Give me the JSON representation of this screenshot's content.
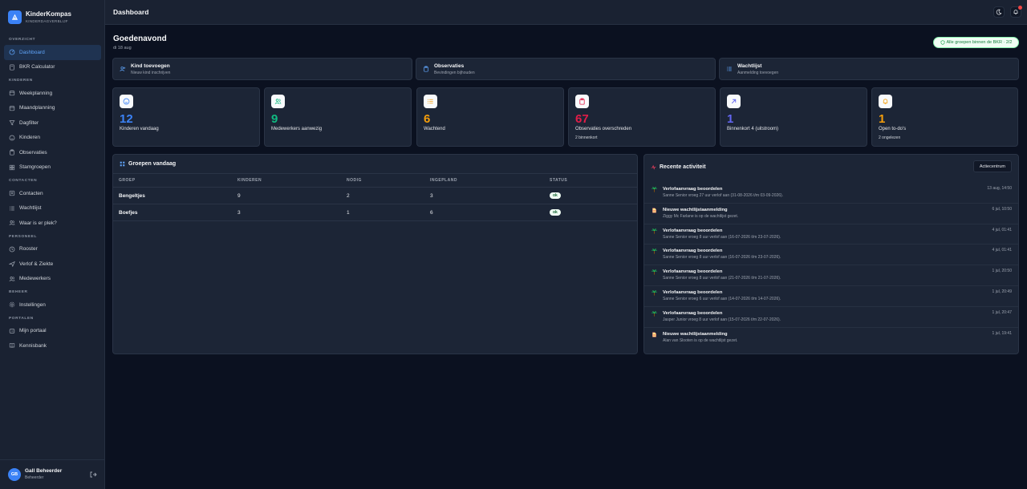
{
  "brand": {
    "name": "KinderKompas",
    "subtitle": "KINDERDAGVERBLIJF"
  },
  "nav": {
    "sections": [
      {
        "title": "OVERZICHT",
        "items": [
          {
            "label": "Dashboard",
            "icon": "dashboard-icon",
            "active": true
          },
          {
            "label": "BKR Calculator",
            "icon": "calculator-icon"
          }
        ]
      },
      {
        "title": "KINDEREN",
        "items": [
          {
            "label": "Weekplanning",
            "icon": "calendar-icon"
          },
          {
            "label": "Maandplanning",
            "icon": "calendar-icon"
          },
          {
            "label": "Dagfilter",
            "icon": "filter-icon"
          },
          {
            "label": "Kinderen",
            "icon": "smile-icon"
          },
          {
            "label": "Observaties",
            "icon": "clipboard-icon"
          },
          {
            "label": "Stamgroepen",
            "icon": "grid-icon"
          }
        ]
      },
      {
        "title": "CONTACTEN",
        "items": [
          {
            "label": "Contacten",
            "icon": "contact-icon"
          },
          {
            "label": "Wachtlijst",
            "icon": "list-icon"
          },
          {
            "label": "Waar is er plek?",
            "icon": "users-icon"
          }
        ]
      },
      {
        "title": "PERSONEEL",
        "items": [
          {
            "label": "Rooster",
            "icon": "clock-icon"
          },
          {
            "label": "Verlof & Ziekte",
            "icon": "plane-icon"
          },
          {
            "label": "Medewerkers",
            "icon": "users-icon"
          }
        ]
      },
      {
        "title": "BEHEER",
        "items": [
          {
            "label": "Instellingen",
            "icon": "gear-icon"
          }
        ]
      },
      {
        "title": "PORTALEN",
        "items": [
          {
            "label": "Mijn portaal",
            "icon": "portal-icon"
          },
          {
            "label": "Kennisbank",
            "icon": "book-icon"
          }
        ]
      }
    ]
  },
  "user": {
    "initials": "GB",
    "name": "Gall Beheerder",
    "role": "Beheerder"
  },
  "topbar": {
    "title": "Dashboard"
  },
  "header": {
    "greeting": "Goedenavond",
    "date": "di 18 aug",
    "bkr_status": "Alle groepen binnen de BKR · 2/2"
  },
  "quick_actions": [
    {
      "title": "Kind toevoegen",
      "subtitle": "Nieuw kind inschrijven",
      "icon": "user-plus-icon"
    },
    {
      "title": "Observaties",
      "subtitle": "Bevindingen bijhouden",
      "icon": "clipboard-icon"
    },
    {
      "title": "Wachtlijst",
      "subtitle": "Aanmelding toevoegen",
      "icon": "list-icon"
    }
  ],
  "stats": [
    {
      "value": "12",
      "label": "Kinderen vandaag",
      "sub": "",
      "color": "#3b82f6",
      "icon": "smile-icon"
    },
    {
      "value": "9",
      "label": "Medewerkers aanwezig",
      "sub": "",
      "color": "#10b981",
      "icon": "users-icon"
    },
    {
      "value": "6",
      "label": "Wachtend",
      "sub": "",
      "color": "#f59e0b",
      "icon": "list-icon"
    },
    {
      "value": "67",
      "label": "Observaties overschreden",
      "sub": "2 binnenkort",
      "color": "#e11d48",
      "icon": "clipboard-icon"
    },
    {
      "value": "1",
      "label": "Binnenkort 4 (uitstroom)",
      "sub": "",
      "color": "#6366f1",
      "icon": "arrow-up-right-icon"
    },
    {
      "value": "1",
      "label": "Open to-do's",
      "sub": "2 ongelezen",
      "color": "#f59e0b",
      "icon": "bell-icon"
    }
  ],
  "groups": {
    "title": "Groepen vandaag",
    "columns": [
      "GROEP",
      "KINDEREN",
      "NODIG",
      "INGEPLAND",
      "STATUS"
    ],
    "rows": [
      {
        "groep": "Bengeltjes",
        "kinderen": "9",
        "nodig": "2",
        "ingepland": "3",
        "status": "ok"
      },
      {
        "groep": "Boefjes",
        "kinderen": "3",
        "nodig": "1",
        "ingepland": "6",
        "status": "ok"
      }
    ]
  },
  "activity": {
    "title": "Recente activiteit",
    "button": "Actiecentrum",
    "items": [
      {
        "icon": "palm-tree-icon",
        "title": "Verlofaanvraag beoordelen",
        "desc": "Sanne Senior vroeg 27 uur verlof aan (31-08-2026 t/m 03-09-2026).",
        "time": "13 aug, 14:50"
      },
      {
        "icon": "document-icon",
        "title": "Nieuwe wachtlijstaanmelding",
        "desc": "Ziggy Mc Farlane is op de wachtlijst gezet.",
        "time": "6 jul, 10:50"
      },
      {
        "icon": "palm-tree-icon",
        "title": "Verlofaanvraag beoordelen",
        "desc": "Sanne Senior vroeg 8 uur verlof aan (16-07-2026 t/m 23-07-2026).",
        "time": "4 jul, 01:41"
      },
      {
        "icon": "palm-tree-icon",
        "title": "Verlofaanvraag beoordelen",
        "desc": "Sanne Senior vroeg 8 uur verlof aan (16-07-2026 t/m 23-07-2026).",
        "time": "4 jul, 01:41"
      },
      {
        "icon": "palm-tree-icon",
        "title": "Verlofaanvraag beoordelen",
        "desc": "Sanne Senior vroeg 8 uur verlof aan (21-07-2026 t/m 21-07-2026).",
        "time": "1 jul, 20:50"
      },
      {
        "icon": "palm-tree-icon",
        "title": "Verlofaanvraag beoordelen",
        "desc": "Sanne Senior vroeg 6 uur verlof aan (14-07-2026 t/m 14-07-2026).",
        "time": "1 jul, 20:49"
      },
      {
        "icon": "palm-tree-icon",
        "title": "Verlofaanvraag beoordelen",
        "desc": "Jasper Junior vroeg 8 uur verlof aan (15-07-2026 t/m 22-07-2026).",
        "time": "1 jul, 20:47"
      },
      {
        "icon": "document-icon",
        "title": "Nieuwe wachtlijstaanmelding",
        "desc": "Alan van Slooten is op de wachtlijst gezet.",
        "time": "1 jul, 19:41"
      }
    ]
  }
}
